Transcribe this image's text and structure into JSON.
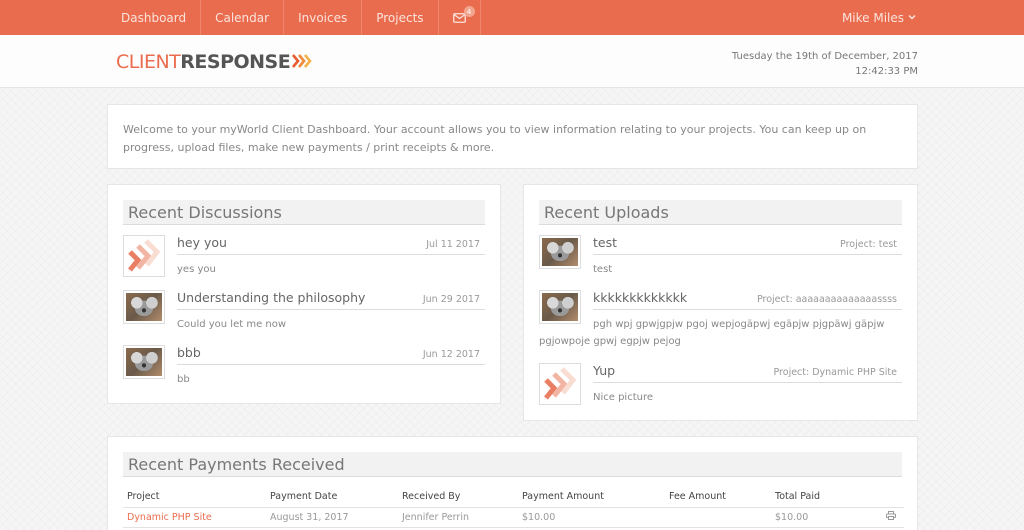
{
  "navbar": {
    "items": [
      {
        "label": "Dashboard"
      },
      {
        "label": "Calendar"
      },
      {
        "label": "Invoices"
      },
      {
        "label": "Projects"
      }
    ],
    "mail": {
      "icon": "envelope-icon",
      "badge_count": "4"
    },
    "user": {
      "name": "Mike Miles",
      "icon": "chevron-down-icon"
    },
    "color": "#ea6c4e"
  },
  "header": {
    "logo": {
      "part1": "CLIENT",
      "part2": "RESPONSE",
      "icon": "triple-chevron-icon"
    },
    "date": "Tuesday the 19th of December, 2017",
    "time": "12:42:33 PM"
  },
  "welcome": {
    "text": "Welcome to your myWorld Client Dashboard. Your account allows you to view information relating to your projects. You can keep up on progress, upload files, make new payments / print receipts & more."
  },
  "discussions": {
    "title": "Recent Discussions",
    "items": [
      {
        "title": "hey you",
        "date": "Jul 11 2017",
        "body": "yes you",
        "avatar": "logo-avatar"
      },
      {
        "title": "Understanding the philosophy",
        "date": "Jun 29 2017",
        "body": "Could you let me now",
        "avatar": "koala-avatar"
      },
      {
        "title": "bbb",
        "date": "Jun 12 2017",
        "body": "bb",
        "avatar": "koala-avatar"
      }
    ]
  },
  "uploads": {
    "title": "Recent Uploads",
    "items": [
      {
        "title": "test",
        "project": "Project: test",
        "body": "test",
        "avatar": "koala-avatar"
      },
      {
        "title": "kkkkkkkkkkkkk",
        "project": "Project: aaaaaaaaaaaaaassss",
        "body": "pgh wpj gpwjgpjw pgoj wepjogäpwj egäpjw pjgpäwj gäpjw pgjowpoje gpwj egpjw pejog",
        "avatar": "koala-avatar"
      },
      {
        "title": "Yup",
        "project": "Project: Dynamic PHP Site",
        "body": "Nice picture",
        "avatar": "logo-avatar"
      }
    ]
  },
  "payments": {
    "title": "Recent Payments Received",
    "columns": [
      "Project",
      "Payment Date",
      "Received By",
      "Payment Amount",
      "Fee Amount",
      "Total Paid",
      ""
    ],
    "rows": [
      {
        "project": "Dynamic PHP Site",
        "date": "August 31, 2017",
        "received_by": "Jennifer Perrin",
        "amount": "$10.00",
        "fee": "",
        "total": "$10.00",
        "action_icon": "print-icon"
      }
    ]
  }
}
